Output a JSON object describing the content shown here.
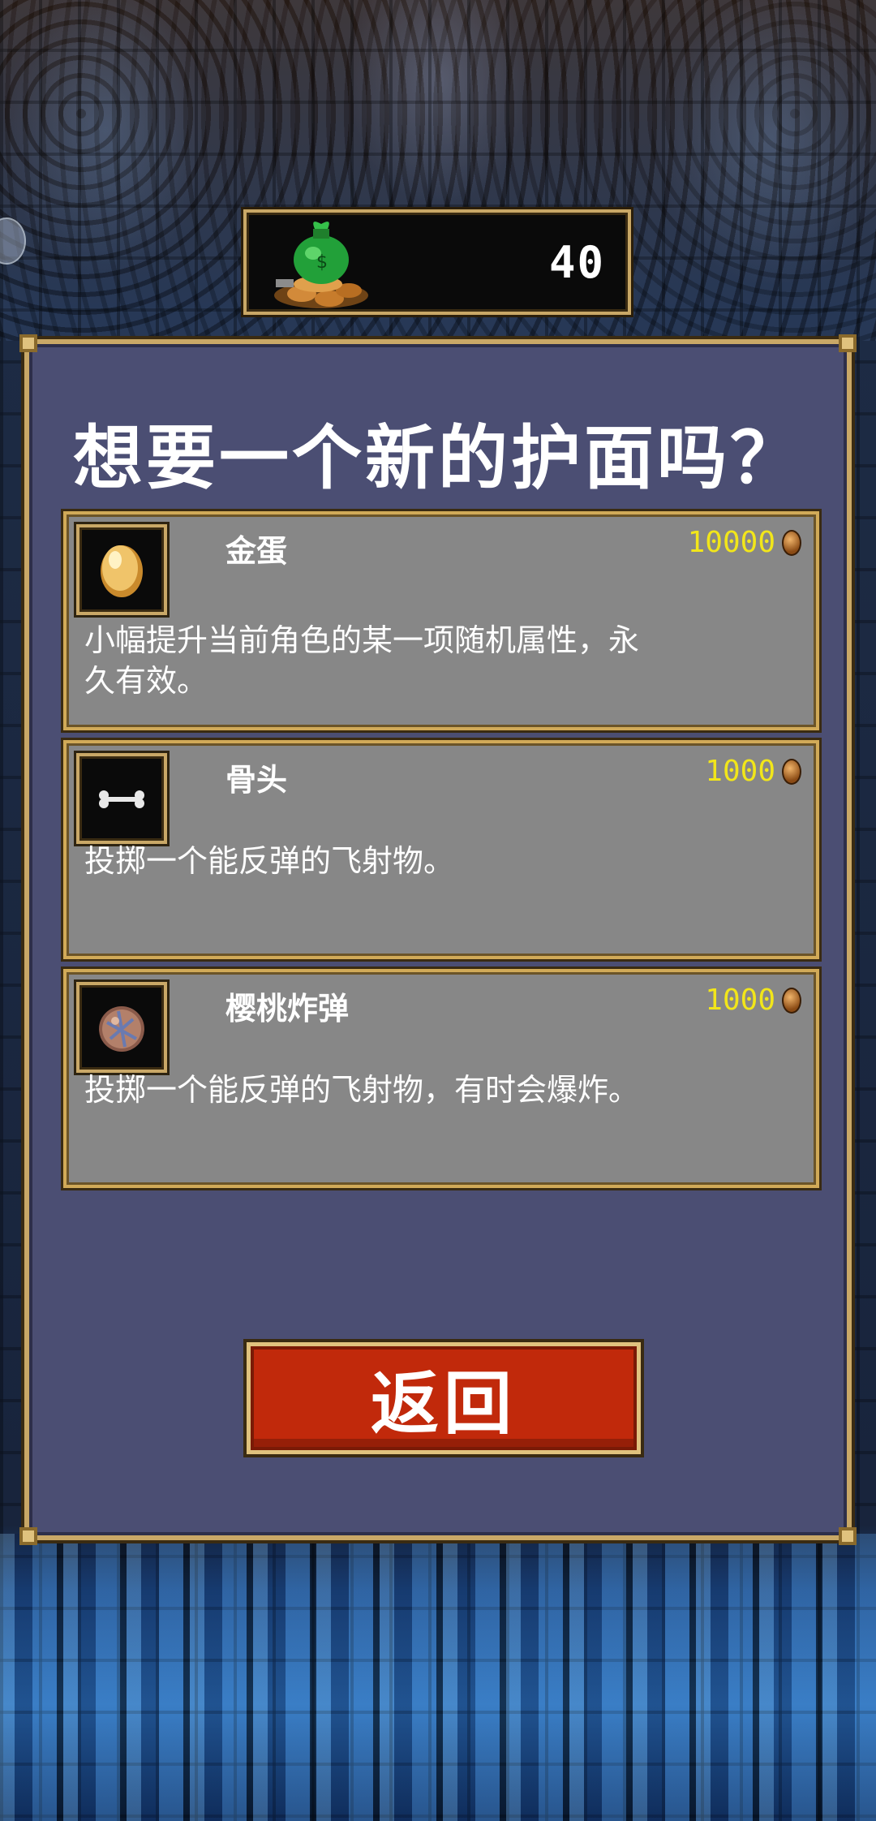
{
  "coins": {
    "count": "40"
  },
  "panel": {
    "title": "想要一个新的护面吗？",
    "items": [
      {
        "name": "金蛋",
        "price": "10000",
        "description": "小幅提升当前角色的某一项随机属性，永\n久有效。",
        "icon": "golden-egg-icon"
      },
      {
        "name": "骨头",
        "price": "1000",
        "description": "投掷一个能反弹的飞射物。",
        "icon": "bone-icon"
      },
      {
        "name": "樱桃炸弹",
        "price": "1000",
        "description": "投掷一个能反弹的飞射物，有时会爆炸。",
        "icon": "cherry-bomb-icon"
      }
    ],
    "back_label": "返回"
  },
  "colors": {
    "panel_bg": "#4b4e73",
    "item_bg": "#878787",
    "gold_border": "#c9a867",
    "price_text": "#f2e61a",
    "button_red": "#c1290b"
  }
}
